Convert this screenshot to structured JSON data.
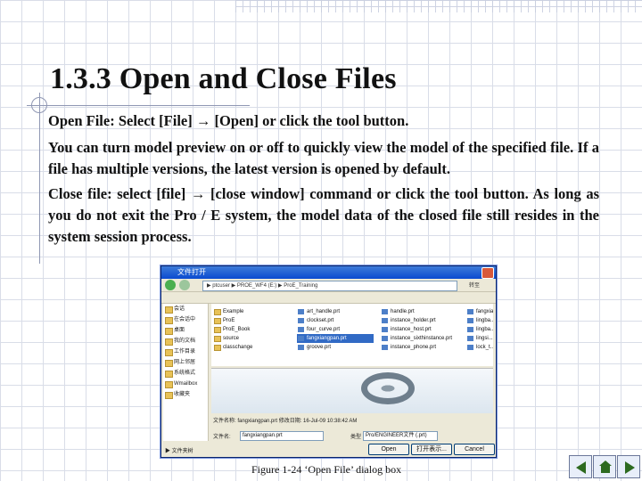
{
  "slide": {
    "title": "1.3.3  Open and Close Files",
    "paragraph1": "Open File: Select [File] → [Open] or click the tool button.",
    "paragraph2": "You can turn model preview on or off to quickly view the model of the specified file. If a file has multiple versions, the latest version is opened by default.",
    "paragraph3": "Close file: select [file] → [close window] command or click the tool button. As long as you do not exit the Pro / E system, the model data of the closed file still resides in the system session process."
  },
  "figure": {
    "window_title": "文件打开",
    "address": "▶ ptcuser ▶ PROE_WF4 (E:) ▶ ProE_Training",
    "go_label": "转至",
    "sidebar": [
      "会话",
      "在会话中",
      "桌面",
      "我的文档",
      "工作目录",
      "网上邻居",
      "系统格式",
      "Wmailbox",
      "收藏夹"
    ],
    "col1": [
      "Example",
      "ProE",
      "ProE_Book",
      "source",
      "classchange"
    ],
    "col2": [
      "art_handle.prt",
      "clockset.prt",
      "four_curve.prt",
      "fangxiangpan.prt",
      "groove.prt"
    ],
    "col3": [
      "handle.prt",
      "instance_holder.prt",
      "instance_host.prt",
      "instance_sixthinstance.prt",
      "instance_phone.prt"
    ],
    "col4": [
      "fangxia...",
      "lingba...",
      "lingba...",
      "lingsi...",
      "lock_t..."
    ],
    "selected_file": "fangxiangpan.prt",
    "name_row": "文件名称: fangxiangpan.prt  修改日期: 16-Jul-09 10:38:42 AM",
    "filename_label": "文件名:",
    "filename_value": "fangxiangpan.prt",
    "type_label": "类型",
    "type_value": "Pro/ENGINEER文件 (.prt)",
    "open_button": "Open",
    "open_more": "打开表示...",
    "cancel_button": "Cancel",
    "folder_tree": "▶ 文件夹树",
    "caption": "Figure 1-24 ‘Open File’ dialog box"
  },
  "nav": {
    "prev_icon": "previous-arrow-icon",
    "home_icon": "home-icon",
    "next_icon": "next-arrow-icon"
  }
}
